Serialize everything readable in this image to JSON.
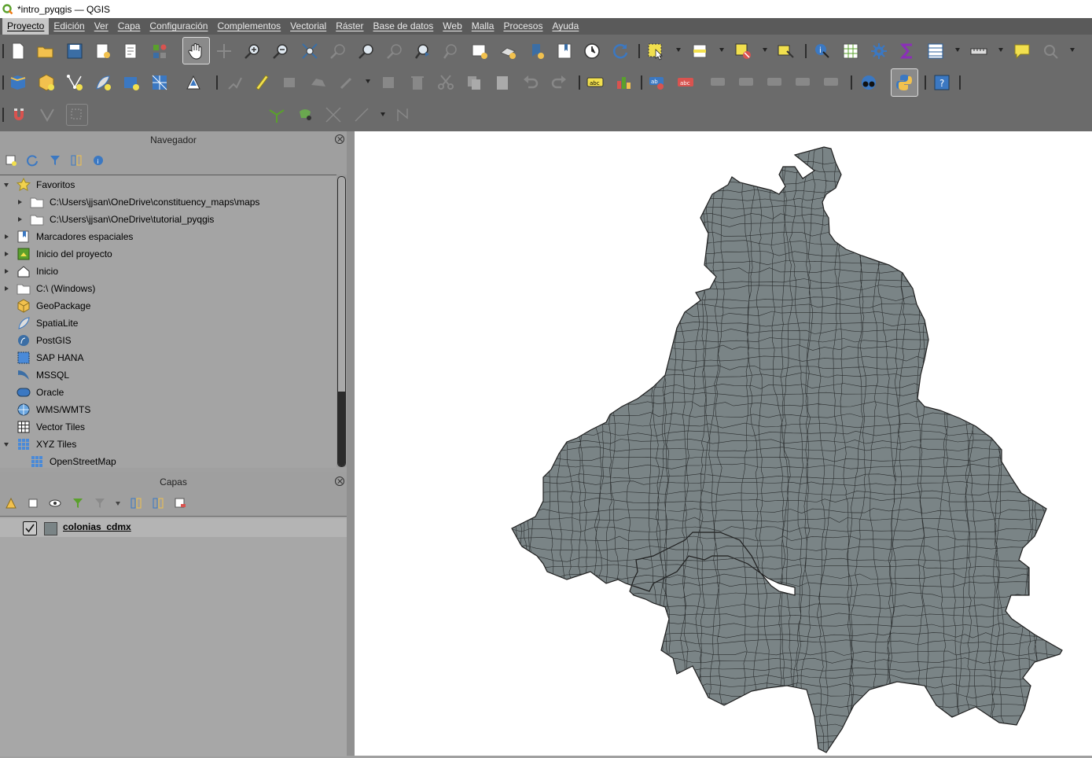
{
  "window": {
    "title": "*intro_pyqgis — QGIS"
  },
  "menu": [
    "Proyecto",
    "Edición",
    "Ver",
    "Capa",
    "Configuración",
    "Complementos",
    "Vectorial",
    "Ráster",
    "Base de datos",
    "Web",
    "Malla",
    "Procesos",
    "Ayuda"
  ],
  "snapping": {
    "tolerance": "12",
    "units": "px"
  },
  "browser": {
    "title": "Navegador",
    "items": [
      {
        "label": "Favoritos",
        "icon": "star-icon",
        "indent": 0,
        "arrow": "down"
      },
      {
        "label": "C:\\Users\\jjsan\\OneDrive\\constituency_maps\\maps",
        "icon": "folder-icon",
        "indent": 1,
        "arrow": "right"
      },
      {
        "label": "C:\\Users\\jjsan\\OneDrive\\tutorial_pyqgis",
        "icon": "folder-icon",
        "indent": 1,
        "arrow": "right"
      },
      {
        "label": "Marcadores espaciales",
        "icon": "bookmark-icon",
        "indent": 0,
        "arrow": "right"
      },
      {
        "label": "Inicio del proyecto",
        "icon": "project-home-icon",
        "indent": 0,
        "arrow": "right"
      },
      {
        "label": "Inicio",
        "icon": "home-icon",
        "indent": 0,
        "arrow": "right"
      },
      {
        "label": "C:\\ (Windows)",
        "icon": "folder-icon",
        "indent": 0,
        "arrow": "right"
      },
      {
        "label": "GeoPackage",
        "icon": "geopackage-icon",
        "indent": 0,
        "arrow": "none"
      },
      {
        "label": "SpatiaLite",
        "icon": "spatialite-icon",
        "indent": 0,
        "arrow": "none"
      },
      {
        "label": "PostGIS",
        "icon": "postgis-icon",
        "indent": 0,
        "arrow": "none"
      },
      {
        "label": "SAP HANA",
        "icon": "saphana-icon",
        "indent": 0,
        "arrow": "none"
      },
      {
        "label": "MSSQL",
        "icon": "mssql-icon",
        "indent": 0,
        "arrow": "none"
      },
      {
        "label": "Oracle",
        "icon": "oracle-icon",
        "indent": 0,
        "arrow": "none"
      },
      {
        "label": "WMS/WMTS",
        "icon": "globe-icon",
        "indent": 0,
        "arrow": "none"
      },
      {
        "label": "Vector Tiles",
        "icon": "vector-tiles-icon",
        "indent": 0,
        "arrow": "none"
      },
      {
        "label": "XYZ Tiles",
        "icon": "xyz-tiles-icon",
        "indent": 0,
        "arrow": "down"
      },
      {
        "label": "OpenStreetMap",
        "icon": "xyz-tiles-icon",
        "indent": 1,
        "arrow": "none"
      }
    ]
  },
  "layers": {
    "title": "Capas",
    "items": [
      {
        "label": "colonias_cdmx",
        "checked": true,
        "fill": "#7a8486"
      }
    ]
  },
  "map": {
    "fill": "#7a8486",
    "stroke": "#1e1e1e",
    "background": "#ffffff"
  }
}
